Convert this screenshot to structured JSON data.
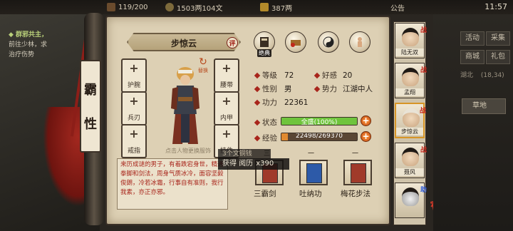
{
  "topbar": {
    "energy": "119/200",
    "money": "1503两104文",
    "gold": "387两",
    "notice": "公告",
    "time": "11:57"
  },
  "quest": {
    "title": "◆ 群邪共主，",
    "line1": "前往少林，求",
    "line2": "治疗伤势"
  },
  "character": {
    "name": "步惊云",
    "ping_label": "评",
    "swap_label": "替换",
    "tip": "点击人物更换服饰"
  },
  "tab_chars": [
    "霸",
    "性"
  ],
  "equip_slots": [
    {
      "id": "huwan",
      "label": "护腕"
    },
    {
      "id": "yaodai",
      "label": "腰带"
    },
    {
      "id": "bingren",
      "label": "兵刃"
    },
    {
      "id": "neijia",
      "label": "内甲"
    },
    {
      "id": "jiezhi",
      "label": "戒指"
    },
    {
      "id": "guajian",
      "label": "挂件"
    }
  ],
  "top_icons": [
    {
      "name": "book-icon",
      "badge": "绝典"
    },
    {
      "name": "treasure-icon",
      "badge": ""
    },
    {
      "name": "taichi-icon",
      "badge": ""
    },
    {
      "name": "meridian-icon",
      "badge": ""
    }
  ],
  "stats": {
    "level_label": "等级",
    "level": "72",
    "favor_label": "好感",
    "favor": "20",
    "gender_label": "性别",
    "gender": "男",
    "faction_label": "势力",
    "faction": "江湖中人",
    "power_label": "功力",
    "power": "22361",
    "status_label": "状态",
    "status_text": "全盛(100%)",
    "status_fraction": 1.0,
    "exp_label": "经验",
    "exp_text": "22498/269370",
    "exp_fraction": 0.0835
  },
  "description": "来历成谜的男子，有着跌宕身世，精通拳脚和剑法，周身气质冰冷，面容坚毅俊朗，冷若冰霜，行事自有准则，我行我素，亦正亦邪。",
  "skills": [
    {
      "name": "三霸剑",
      "dash": "三",
      "color": "#a03a2a"
    },
    {
      "name": "吐纳功",
      "dash": "一",
      "color": "#2d5aa8"
    },
    {
      "name": "梅花步法",
      "dash": "一",
      "color": "#a03a2a"
    }
  ],
  "toast": {
    "line1": "3个文铜钱",
    "line2_prefix": "获得 阅历",
    "line2_qty": "x390"
  },
  "party": [
    {
      "name": "陆无双",
      "tag": "战"
    },
    {
      "name": "孟翔",
      "tag": "战"
    },
    {
      "name": "步惊云",
      "tag": "战",
      "selected": true
    },
    {
      "name": "聂风",
      "tag": "战"
    },
    {
      "name": "",
      "tag": "助"
    }
  ],
  "stamp": "宿命",
  "right_menu": {
    "btn_activity": "活动",
    "btn_rank": "采集",
    "btn_shop": "商城",
    "btn_gift": "礼包",
    "location_label": "湖北",
    "location_coords": "(18,34)",
    "tab_region": "草地"
  },
  "colors": {
    "status_fill": "#6fc43c",
    "exp_fill": "#e08a30",
    "accent_red": "#a8251b"
  }
}
